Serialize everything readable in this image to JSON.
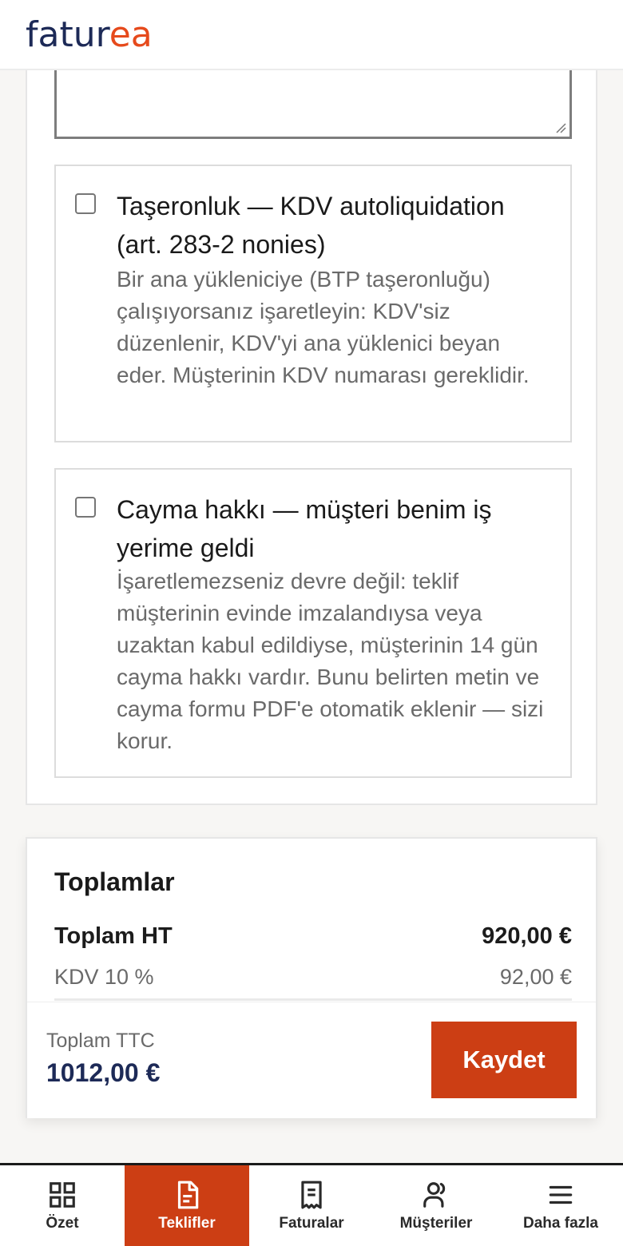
{
  "brand": {
    "part1": "fatur",
    "part2": "ea"
  },
  "options": [
    {
      "title": "Taşeronluk — KDV autoliquidation (art. 283-2 nonies)",
      "description": "Bir ana yükleniciye (BTP taşeronluğu) çalışıyorsanız işaretleyin: KDV'siz düzenlenir, KDV'yi ana yüklenici beyan eder. Müşterinin KDV numarası gereklidir.",
      "checked": false
    },
    {
      "title": "Cayma hakkı — müşteri benim iş yerime geldi",
      "description": "İşaretlemezseniz devre değil: teklif müşterinin evinde imzalandıysa veya uzaktan kabul edildiyse, müşterinin 14 gün cayma hakkı vardır. Bunu belirten metin ve cayma formu PDF'e otomatik eklenir — sizi korur.",
      "checked": false
    }
  ],
  "totals": {
    "heading": "Toplamlar",
    "ht_label": "Toplam HT",
    "ht_value": "920,00 €",
    "kdv_label": "KDV 10 %",
    "kdv_value": "92,00 €",
    "ttc_label": "Toplam TTC",
    "ttc_value": "1012,00 €",
    "save_label": "Kaydet"
  },
  "nav": [
    {
      "label": "Özet",
      "icon": "grid-icon",
      "active": false
    },
    {
      "label": "Teklifler",
      "icon": "document-icon",
      "active": true
    },
    {
      "label": "Faturalar",
      "icon": "receipt-icon",
      "active": false
    },
    {
      "label": "Müşteriler",
      "icon": "users-icon",
      "active": false
    },
    {
      "label": "Daha fazla",
      "icon": "menu-icon",
      "active": false
    }
  ],
  "colors": {
    "accent": "#cc3e14",
    "brand_dark": "#1d2a57",
    "brand_orange": "#e64a1c"
  }
}
